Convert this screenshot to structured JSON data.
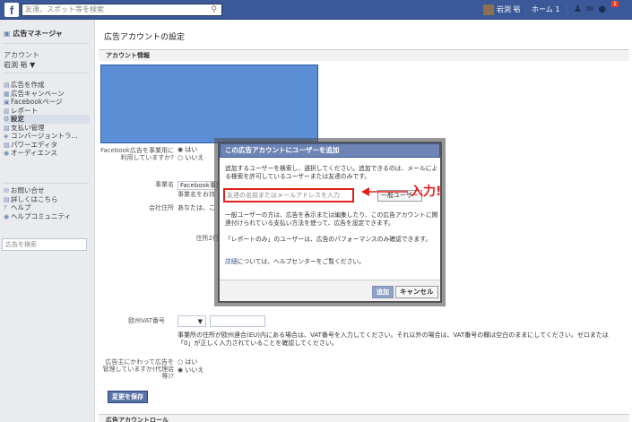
{
  "topbar": {
    "logo": "f",
    "search_placeholder": "友達、スポット等を検索",
    "user_name": "岩渕 裕",
    "home_label": "ホーム",
    "home_count": "1",
    "notif_count": "1"
  },
  "sidebar": {
    "title": "広告マネージャ",
    "account_label": "アカウント",
    "account_name": "岩渕 裕 ▼",
    "items": [
      {
        "icon": "▤",
        "label": "広告を作成"
      },
      {
        "icon": "▦",
        "label": "広告キャンペーン"
      },
      {
        "icon": "▣",
        "label": "Facebookページ"
      },
      {
        "icon": "▥",
        "label": "レポート"
      },
      {
        "icon": "⚙",
        "label": "設定"
      },
      {
        "icon": "▧",
        "label": "支払い管理"
      },
      {
        "icon": "◈",
        "label": "コンバージョントラ..."
      },
      {
        "icon": "▨",
        "label": "パワーエディタ"
      },
      {
        "icon": "◉",
        "label": "オーディエンス"
      }
    ],
    "help_items": [
      {
        "icon": "✉",
        "label": "お問い合せ"
      },
      {
        "icon": "▤",
        "label": "詳しくはこちら"
      },
      {
        "icon": "?",
        "label": "ヘルプ"
      },
      {
        "icon": "◉",
        "label": "ヘルプコミュニティ"
      }
    ],
    "search_placeholder": "広告を検索"
  },
  "main": {
    "title": "広告アカウントの設定",
    "section_account": "アカウント情報",
    "business_use_label": "Facebook広告を事業用に利用していますか?",
    "yes": "はい",
    "no": "いいえ",
    "company_label": "事業名",
    "company_value": "Facebook事業",
    "company_note": "事業名をお持",
    "address_label": "会社住所",
    "address_value": "あなたは、こ",
    "address2_label": "住所2行",
    "vat_label": "欧州VAT番号",
    "vat_select": "▼",
    "vat_note": "事業所の住所が欧州連合(EU)内にある場合は、VAT番号を入力してください。それ以外の場合は、VAT番号の欄は空白のままにしてください。ゼロまたは「0」が正しく入力されていることを確認してください。",
    "agency_label": "広告主にかわって広告を管理していますか(代理店等)?",
    "agency_yes": "はい",
    "agency_no": "いいえ",
    "save_button": "変更を保存",
    "section_roles": "広告アカウントロール"
  },
  "dialog": {
    "title": "この広告アカウントにユーザーを追加",
    "text1": "追加するユーザーを検索し、選択してください。追加できるのは、メールによる検索を許可しているユーザーまたは友達のみです。",
    "input_placeholder": "友達の名前またはメールアドレスを入力",
    "role_select": "一般ユーザー",
    "text2": "一般ユーザーの方は、広告を表示または編集したり、この広告アカウントに関連付けられている支払い方法を使って、広告を設定できます。",
    "text3": "「レポートのみ」のユーザーは、広告のパフォーマンスのみ確認できます。",
    "text4_link": "詳細",
    "text4": "については、ヘルプセンターをご覧ください。",
    "ok_button": "追加",
    "cancel_button": "キャンセル"
  },
  "annotation": {
    "text": "入力!",
    "color": "#e2201c"
  }
}
